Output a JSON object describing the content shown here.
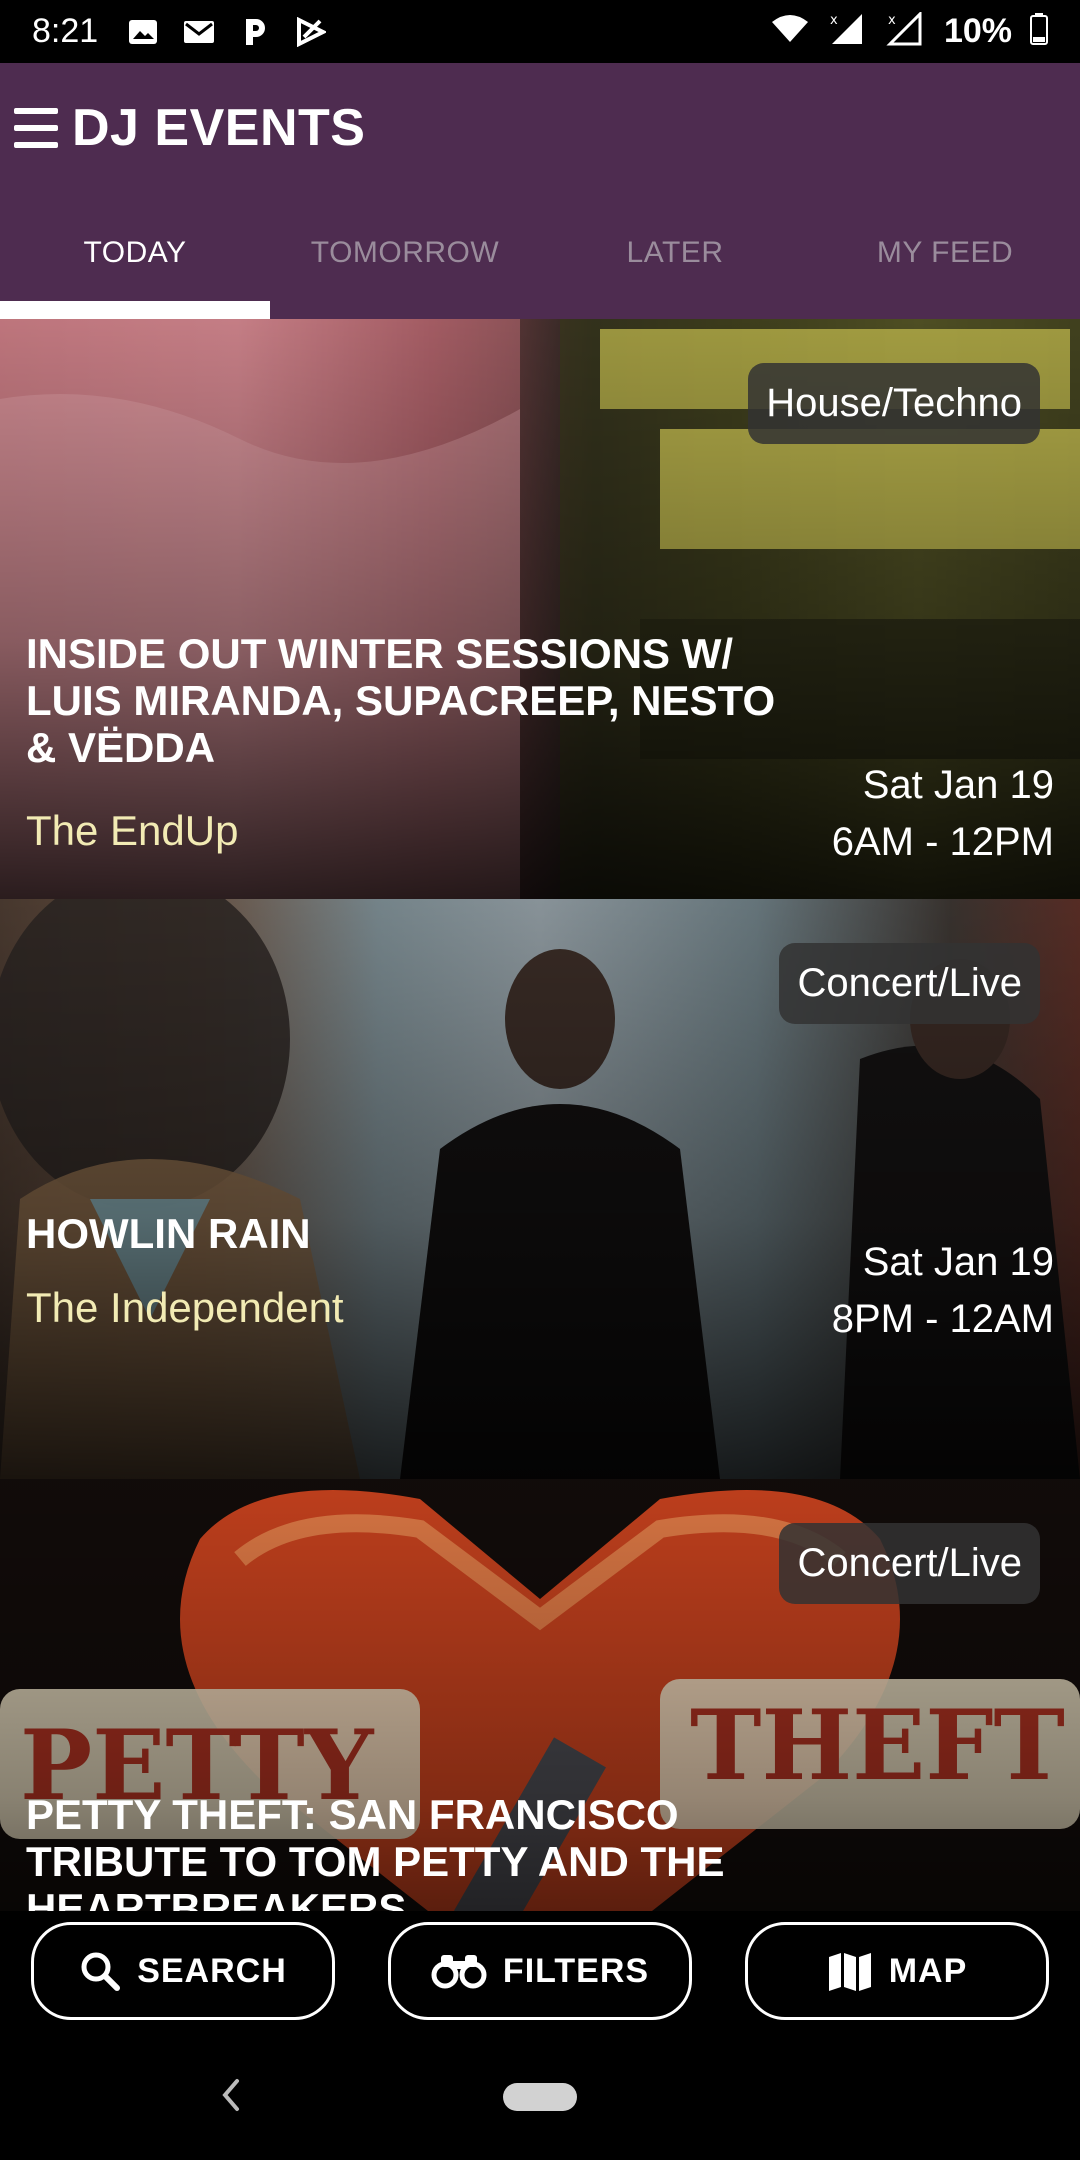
{
  "status_bar": {
    "time": "8:21",
    "battery": "10%",
    "icons": [
      "image-icon",
      "gmail-icon",
      "pandora-icon",
      "play-store-icon",
      "wifi-icon",
      "signal-icon",
      "signal-2-icon",
      "battery-icon"
    ]
  },
  "app_bar": {
    "title": "DJ EVENTS",
    "background": "#4e2c50",
    "tabs": [
      {
        "label": "TODAY",
        "active": true
      },
      {
        "label": "TOMORROW",
        "active": false
      },
      {
        "label": "LATER",
        "active": false
      },
      {
        "label": "MY FEED",
        "active": false
      }
    ]
  },
  "events": [
    {
      "title": "INSIDE OUT WINTER SESSIONS W/ LUIS MIRANDA, SUPACREEP, NESTO & VËDDA",
      "venue": "The EndUp",
      "date": "Sat Jan 19",
      "time": "6AM - 12PM",
      "genre": "House/Techno"
    },
    {
      "title": "HOWLIN RAIN",
      "venue": "The Independent",
      "date": "Sat Jan 19",
      "time": "8PM - 12AM",
      "genre": "Concert/Live"
    },
    {
      "title": "PETTY THEFT: SAN FRANCISCO TRIBUTE TO TOM PETTY AND THE HEARTBREAKERS",
      "genre": "Concert/Live"
    }
  ],
  "bottom_actions": {
    "search": "SEARCH",
    "filters": "FILTERS",
    "map": "MAP"
  },
  "colors": {
    "accent": "#4e2c50",
    "venue_text": "#f2ebb4"
  }
}
